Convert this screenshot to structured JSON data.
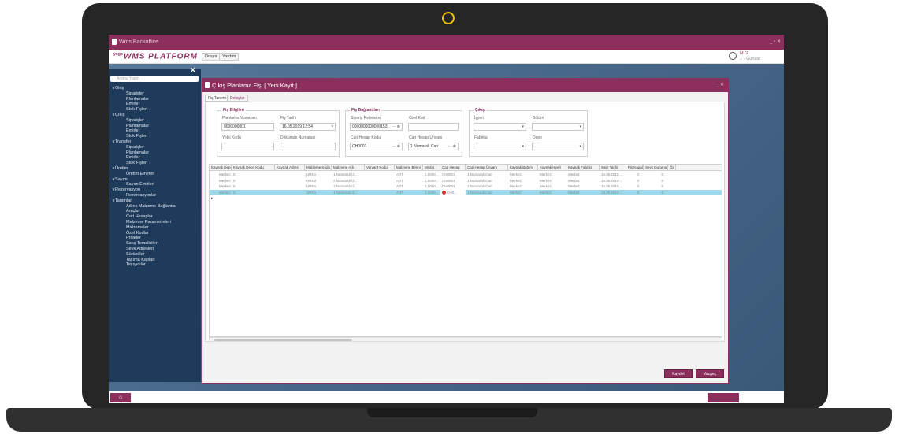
{
  "window": {
    "title": "Wms Backoffice",
    "controls": "_ ▫ ✕"
  },
  "brand": {
    "prefix": "yogo",
    "name": "WMS PLATFORM"
  },
  "menu": {
    "file": "Dosya",
    "help": "Yardım"
  },
  "user": {
    "name": "M G",
    "sub": "1 - Günata"
  },
  "sidebar": {
    "search_placeholder": "Arama Yapın",
    "items": [
      {
        "label": "Giriş",
        "type": "group"
      },
      {
        "label": "Siparişler",
        "type": "child"
      },
      {
        "label": "Planlamalar",
        "type": "child"
      },
      {
        "label": "Emirler",
        "type": "child"
      },
      {
        "label": "Stok Fişleri",
        "type": "child"
      },
      {
        "label": "Çıkış",
        "type": "group"
      },
      {
        "label": "Siparişler",
        "type": "child"
      },
      {
        "label": "Planlamalar",
        "type": "child"
      },
      {
        "label": "Emirler",
        "type": "child"
      },
      {
        "label": "Stok Fişleri",
        "type": "child"
      },
      {
        "label": "Transfer",
        "type": "group"
      },
      {
        "label": "Siparişler",
        "type": "child"
      },
      {
        "label": "Planlamalar",
        "type": "child"
      },
      {
        "label": "Emirler",
        "type": "child"
      },
      {
        "label": "Stok Fişleri",
        "type": "child"
      },
      {
        "label": "Üretim",
        "type": "group"
      },
      {
        "label": "Üretim Emirleri",
        "type": "child"
      },
      {
        "label": "Sayım",
        "type": "group"
      },
      {
        "label": "Sayım Emirleri",
        "type": "child"
      },
      {
        "label": "Rezervasyon",
        "type": "group"
      },
      {
        "label": "Rezervasyonlar",
        "type": "child"
      },
      {
        "label": "Tanımlar",
        "type": "group"
      },
      {
        "label": "Adres Malzeme Bağlantısı",
        "type": "child"
      },
      {
        "label": "Araçlar",
        "type": "child"
      },
      {
        "label": "Cari Hesaplar",
        "type": "child"
      },
      {
        "label": "Malzeme Parametreleri",
        "type": "child"
      },
      {
        "label": "Malzemeler",
        "type": "child"
      },
      {
        "label": "Özel Kodlar",
        "type": "child"
      },
      {
        "label": "Projeler",
        "type": "child"
      },
      {
        "label": "Satış Temsilcileri",
        "type": "child"
      },
      {
        "label": "Sevk Adresleri",
        "type": "child"
      },
      {
        "label": "Sürücüler",
        "type": "child"
      },
      {
        "label": "Taşıma Kapları",
        "type": "child"
      },
      {
        "label": "Taşıyıcılar",
        "type": "child"
      }
    ]
  },
  "dialog": {
    "title": "Çıkış Planlama Fişi [ Yeni Kayıt ]",
    "tabs": [
      "Fiş Tanımı",
      "Detaylar"
    ],
    "group1": {
      "title": "Fiş Bilgileri",
      "plan_no_label": "Planlama Numarası",
      "plan_no": "0000000001",
      "date_label": "Fiş Tarihi",
      "date": "16.05.2019 12:54",
      "auth_label": "Yetki Kodu",
      "auth": "",
      "doc_label": "Döküman Numarası",
      "doc": ""
    },
    "group2": {
      "title": "Fiş Bağlantıları",
      "order_ref_label": "Sipariş Referansı",
      "order_ref": "0000000000000153",
      "special_label": "Özel Kod",
      "special": "",
      "acc_code_label": "Cari Hesap Kodu",
      "acc_code": "CH0001",
      "acc_title_label": "Cari Hesap Ünvanı",
      "acc_title": "1 Numaralı Cari"
    },
    "group3": {
      "title": "Çıkış",
      "workplace_label": "İşyeri",
      "section_label": "Bölüm",
      "factory_label": "Fabrika",
      "warehouse_label": "Depo"
    },
    "grid": {
      "headers": [
        "Kaynak Depo",
        "Kaynak Depo Kodu",
        "Kaynak Adres",
        "Malzeme Kodu",
        "Malzeme Adı",
        "Varyant Kodu",
        "Malzeme Birimi",
        "Miktar",
        "Cari Hesap",
        "Cari Hesap Ünvanı",
        "Kaynak Bölüm",
        "Kaynak İşyeri",
        "Kaynak Fabrika",
        "Satır Tarihi",
        "Fiş Kapalı",
        "Sevk Durumu",
        "Öz"
      ],
      "rows": [
        [
          "Merkez",
          "0",
          "",
          "URN1",
          "1 Numaralı Ü...",
          "",
          "ADT",
          "1,0000...",
          "CH0001",
          "1 Numaralı Cari",
          "Merkez",
          "Merkez",
          "Merkez",
          "16.05.2019 ...",
          "0",
          "0"
        ],
        [
          "Merkez",
          "0",
          "",
          "URN2",
          "2 Numaralı Ü...",
          "",
          "ADT",
          "1,0000...",
          "CH0001",
          "1 Numaralı Cari",
          "Merkez",
          "Merkez",
          "Merkez",
          "16.05.2019 ...",
          "0",
          "0"
        ],
        [
          "Merkez",
          "0",
          "",
          "URN1",
          "1 Numaralı Ü...",
          "",
          "ADT",
          "1,0000...",
          "CH0001",
          "1 Numaralı Cari",
          "Merkez",
          "Merkez",
          "Merkez",
          "16.05.2019 ...",
          "0",
          "0"
        ],
        [
          "Merkez",
          "0",
          "",
          "URN1",
          "1 Numaralı Ü...",
          "",
          "ADT",
          "1,0000...",
          "CH0...",
          "1 Numaralı Cari",
          "Merkez",
          "Merkez",
          "Merkez",
          "16.05.2019 ...",
          "0",
          "0"
        ]
      ],
      "selected_row": 3
    },
    "buttons": {
      "save": "Kaydet",
      "cancel": "Vazgeç"
    }
  },
  "colors": {
    "accent": "#8c2f5c",
    "sidebar": "#1f3b5c",
    "selection": "#9ed8ec"
  }
}
